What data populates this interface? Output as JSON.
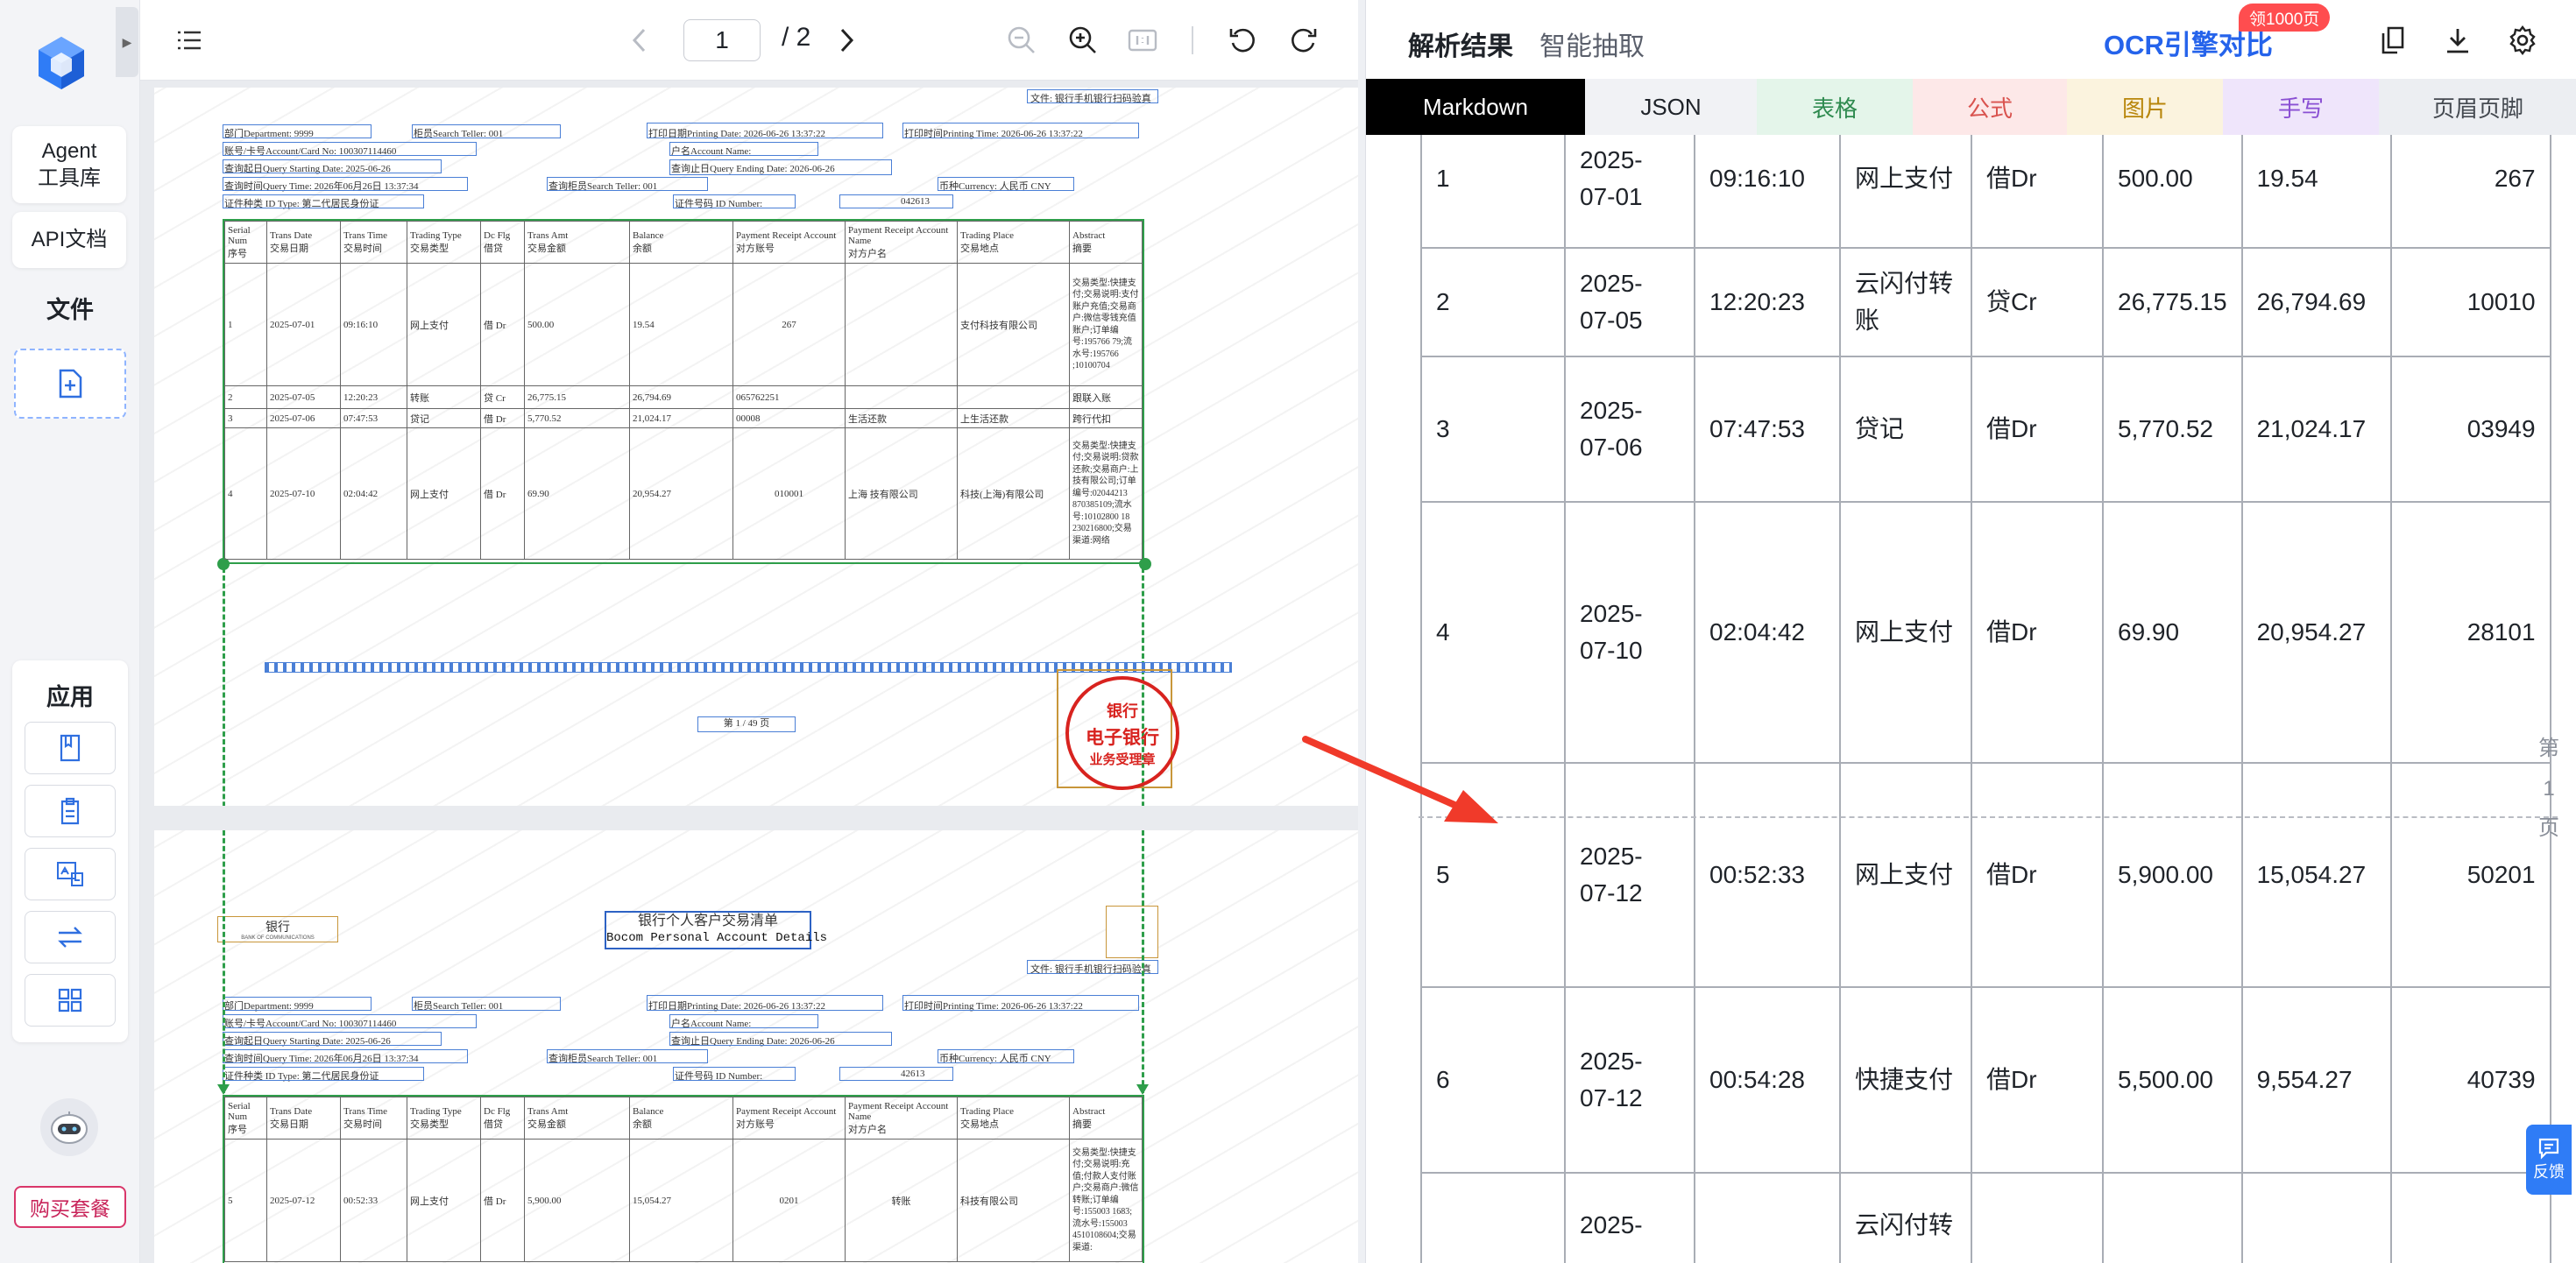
{
  "nav": {
    "agent_label": "Agent\n工具库",
    "api_label": "API文档",
    "files_title": "文件",
    "apps_title": "应用",
    "buy_label": "购买套餐",
    "icons": [
      "upload-file-icon",
      "book-icon",
      "clipboard-icon",
      "image-translate-icon",
      "compare-icon",
      "grid-icon"
    ]
  },
  "viewer": {
    "toolbar": {
      "page_current": "1",
      "page_total": "/ 2"
    },
    "page1": {
      "header_rows": [
        "部门Department:        9999",
        "柜员Search Teller:          001",
        "打印日期Printing Date:  2026-06-26 13:37:22",
        "打印时间Printing Time:  2026-06-26 13:37:22",
        "账号/卡号Account/Card No:         100307114460",
        "户名Account Name:",
        "查询起日Query Starting Date:  2025-06-26",
        "查询止日Query Ending Date:  2026-06-26",
        "查询时间Query Time:  2026年06月26日  13:37:34",
        "查询柜员Search Teller:          001",
        "币种Currency:  人民币 CNY",
        "证件种类 ID Type:  第二代居民身份证",
        "证件号码 ID Number:",
        "042613"
      ],
      "phone_note": "文件:    银行手机银行扫码验真",
      "columns": [
        "Serial Num\n序号",
        "Trans Date\n交易日期",
        "Trans Time\n交易时间",
        "Trading Type\n交易类型",
        "Dc Flg\n借贷",
        "Trans Amt\n交易金额",
        "Balance\n余额",
        "Payment Receipt Account\n对方账号",
        "Payment Receipt Account Name\n对方户名",
        "Trading Place\n交易地点",
        "Abstract\n摘要"
      ],
      "rows": [
        [
          "1",
          "2025-07-01",
          "09:16:10",
          "网上支付",
          "借 Dr",
          "500.00",
          "19.54",
          "267",
          "",
          "支付科技有限公司",
          "交易类型:快捷支付;交易说明:支付账户充值;交易商户:微信零钱充值账户;订单编号:195766 79;流水号:195766 ;10100704"
        ],
        [
          "2",
          "2025-07-05",
          "12:20:23",
          "转账",
          "贷 Cr",
          "26,775.15",
          "26,794.69",
          "065762251",
          "",
          "",
          "跟联入账"
        ],
        [
          "3",
          "2025-07-06",
          "07:47:53",
          "贷记",
          "借 Dr",
          "5,770.52",
          "21,024.17",
          "00008",
          "生活还款",
          "上生活还款",
          "跨行代扣"
        ],
        [
          "4",
          "2025-07-10",
          "02:04:42",
          "网上支付",
          "借 Dr",
          "69.90",
          "20,954.27",
          "010001",
          "上海 技有限公司",
          "科技(上海)有限公司",
          "交易类型:快捷支付;交易说明:贷款还款;交易商户:上技有限公司;订单编号:02044213 870385109;流水号:10102800 18 230216800;交易渠道:网络"
        ]
      ],
      "footer": "第  1  / 49  页",
      "stamp_line1": "电子银行",
      "stamp_line2": "业务受理章",
      "stamp_top": "银行"
    },
    "page2": {
      "bank_logo": "银行",
      "bank_logo_sub": "BANK OF COMMUNICATIONS",
      "title_cn": "银行个人客户交易清单",
      "title_en": "Bocom Personal Account Details",
      "header_rows": [
        "部门Department:        9999",
        "柜员Search Teller:          001",
        "打印日期Printing Date:  2026-06-26 13:37:22",
        "打印时间Printing Time:  2026-06-26 13:37:22",
        "账号/卡号Account/Card No:         100307114460",
        "户名Account Name:",
        "查询起日Query Starting Date:  2025-06-26",
        "查询止日Query Ending Date:  2026-06-26",
        "查询时间Query Time:  2026年06月26日  13:37:34",
        "查询柜员Search Teller:          001",
        "币种Currency:  人民币 CNY",
        "证件种类 ID Type:  第二代居民身份证",
        "证件号码 ID Number:",
        "42613"
      ],
      "phone_note": "文件:    银行手机银行扫码验真",
      "row5": [
        "5",
        "2025-07-12",
        "00:52:33",
        "网上支付",
        "借 Dr",
        "5,900.00",
        "15,054.27",
        "0201",
        "转账",
        "科技有限公司",
        "交易类型:快捷支付;交易说明:充值;付款人支付账户;交易商户:微信转账;订单编号:155003 1683;流水号:155003 4510108604;交易渠道:"
      ]
    }
  },
  "results": {
    "tabs": [
      "解析结果",
      "智能抽取"
    ],
    "active_tab": 0,
    "ocr_compare": "OCR引擎对比",
    "promo_badge": "领1000页",
    "format_tabs": [
      {
        "label": "Markdown",
        "bg": "#000000",
        "fg": "#ffffff"
      },
      {
        "label": "JSON",
        "bg": "#f1f2f5",
        "fg": "#1f2329"
      },
      {
        "label": "表格",
        "bg": "#e4f5ea",
        "fg": "#2e8a4f"
      },
      {
        "label": "公式",
        "bg": "#fde8e8",
        "fg": "#d9534f"
      },
      {
        "label": "图片",
        "bg": "#fbf3de",
        "fg": "#b8860b"
      },
      {
        "label": "手写",
        "bg": "#efe5fb",
        "fg": "#8a4fd3"
      },
      {
        "label": "页眉页脚",
        "bg": "#eceef2",
        "fg": "#444950"
      }
    ],
    "table_rows": [
      [
        "1",
        "2025-\n07-01",
        "09:16:10",
        "网上支付",
        "借Dr",
        "500.00",
        "19.54",
        "267"
      ],
      [
        "2",
        "2025-\n07-05",
        "12:20:23",
        "云闪付转\n账",
        "贷Cr",
        "26,775.15",
        "26,794.69",
        "10010"
      ],
      [
        "3",
        "2025-\n07-06",
        "07:47:53",
        "贷记",
        "借Dr",
        "5,770.52",
        "21,024.17",
        "03949"
      ],
      [
        "4",
        "2025-\n07-10",
        "02:04:42",
        "网上支付",
        "借Dr",
        "69.90",
        "20,954.27",
        "28101"
      ],
      [
        "5",
        "2025-\n07-12",
        "00:52:33",
        "网上支付",
        "借Dr",
        "5,900.00",
        "15,054.27",
        "50201"
      ],
      [
        "6",
        "2025-\n07-12",
        "00:54:28",
        "快捷支付",
        "借Dr",
        "5,500.00",
        "9,554.27",
        "40739"
      ],
      [
        "",
        "2025-",
        "",
        "云闪付转",
        "",
        "",
        "",
        ""
      ]
    ],
    "page_marker": "第\n1\n页",
    "feedback_label": "反馈"
  }
}
